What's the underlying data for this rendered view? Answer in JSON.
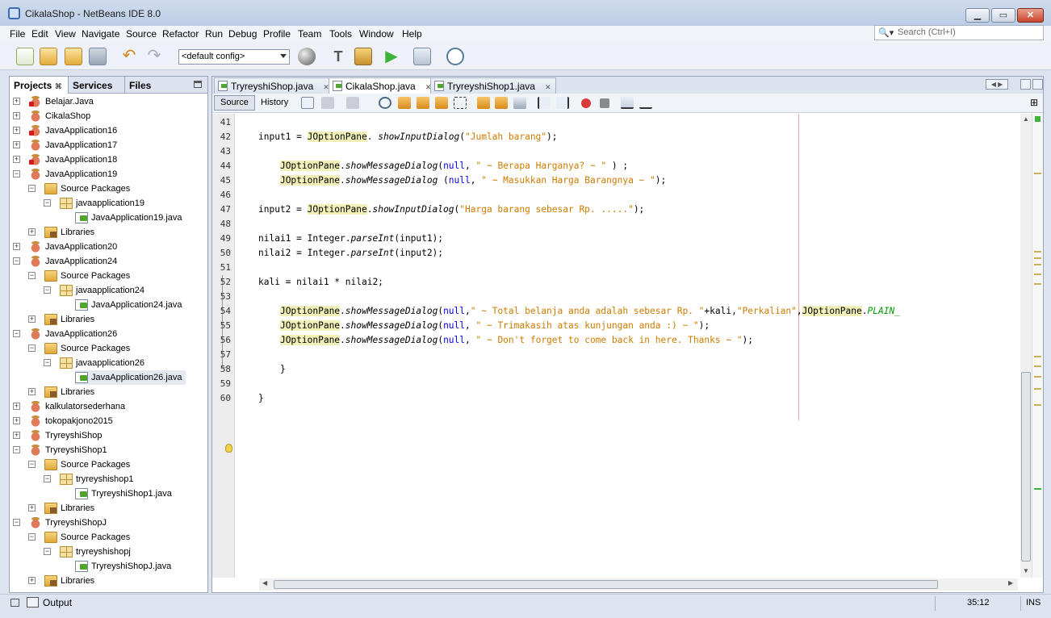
{
  "window": {
    "title": "CikalaShop - NetBeans IDE 8.0"
  },
  "menu": [
    "File",
    "Edit",
    "View",
    "Navigate",
    "Source",
    "Refactor",
    "Run",
    "Debug",
    "Profile",
    "Team",
    "Tools",
    "Window",
    "Help"
  ],
  "search": {
    "placeholder": "Search (Ctrl+I)"
  },
  "toolbar": {
    "config": "<default config>"
  },
  "panel": {
    "tabs": [
      "Projects",
      "Services",
      "Files"
    ]
  },
  "tree": [
    {
      "label": "Belajar.Java",
      "level": 0,
      "type": "project",
      "expanded": false,
      "error": true
    },
    {
      "label": "CikalaShop",
      "level": 0,
      "type": "project",
      "expanded": false,
      "error": false
    },
    {
      "label": "JavaApplication16",
      "level": 0,
      "type": "project",
      "expanded": false,
      "error": true
    },
    {
      "label": "JavaApplication17",
      "level": 0,
      "type": "project",
      "expanded": false,
      "error": false
    },
    {
      "label": "JavaApplication18",
      "level": 0,
      "type": "project",
      "expanded": false,
      "error": true
    },
    {
      "label": "JavaApplication19",
      "level": 0,
      "type": "project",
      "expanded": true,
      "error": false
    },
    {
      "label": "Source Packages",
      "level": 1,
      "type": "folder",
      "expanded": true
    },
    {
      "label": "javaapplication19",
      "level": 2,
      "type": "package",
      "expanded": true
    },
    {
      "label": "JavaApplication19.java",
      "level": 3,
      "type": "java"
    },
    {
      "label": "Libraries",
      "level": 1,
      "type": "lib",
      "expanded": false
    },
    {
      "label": "JavaApplication20",
      "level": 0,
      "type": "project",
      "expanded": false,
      "error": false
    },
    {
      "label": "JavaApplication24",
      "level": 0,
      "type": "project",
      "expanded": true,
      "error": false
    },
    {
      "label": "Source Packages",
      "level": 1,
      "type": "folder",
      "expanded": true
    },
    {
      "label": "javaapplication24",
      "level": 2,
      "type": "package",
      "expanded": true
    },
    {
      "label": "JavaApplication24.java",
      "level": 3,
      "type": "java"
    },
    {
      "label": "Libraries",
      "level": 1,
      "type": "lib",
      "expanded": false
    },
    {
      "label": "JavaApplication26",
      "level": 0,
      "type": "project",
      "expanded": true,
      "error": false
    },
    {
      "label": "Source Packages",
      "level": 1,
      "type": "folder",
      "expanded": true
    },
    {
      "label": "javaapplication26",
      "level": 2,
      "type": "package",
      "expanded": true
    },
    {
      "label": "JavaApplication26.java",
      "level": 3,
      "type": "java",
      "selected": true
    },
    {
      "label": "Libraries",
      "level": 1,
      "type": "lib",
      "expanded": false
    },
    {
      "label": "kalkulatorsederhana",
      "level": 0,
      "type": "project",
      "expanded": false,
      "error": false
    },
    {
      "label": "tokopakjono2015",
      "level": 0,
      "type": "project",
      "expanded": false,
      "error": false
    },
    {
      "label": "TryreyshiShop",
      "level": 0,
      "type": "project",
      "expanded": false,
      "error": false
    },
    {
      "label": "TryreyshiShop1",
      "level": 0,
      "type": "project",
      "expanded": true,
      "error": false
    },
    {
      "label": "Source Packages",
      "level": 1,
      "type": "folder",
      "expanded": true
    },
    {
      "label": "tryreyshishop1",
      "level": 2,
      "type": "package",
      "expanded": true
    },
    {
      "label": "TryreyshiShop1.java",
      "level": 3,
      "type": "java"
    },
    {
      "label": "Libraries",
      "level": 1,
      "type": "lib",
      "expanded": false
    },
    {
      "label": "TryreyshiShopJ",
      "level": 0,
      "type": "project",
      "expanded": true,
      "error": false
    },
    {
      "label": "Source Packages",
      "level": 1,
      "type": "folder",
      "expanded": true
    },
    {
      "label": "tryreyshishopj",
      "level": 2,
      "type": "package",
      "expanded": true
    },
    {
      "label": "TryreyshiShopJ.java",
      "level": 3,
      "type": "java"
    },
    {
      "label": "Libraries",
      "level": 1,
      "type": "lib",
      "expanded": false
    }
  ],
  "editor": {
    "tabs": [
      {
        "label": "TryreyshiShop.java",
        "active": false
      },
      {
        "label": "CikalaShop.java",
        "active": true
      },
      {
        "label": "TryreyshiShop1.java",
        "active": false
      }
    ],
    "source_label": "Source",
    "history_label": "History",
    "lines": [
      {
        "n": "41",
        "segs": []
      },
      {
        "n": "42",
        "segs": [
          [
            "",
            "input1 = "
          ],
          [
            "cls",
            "JOptionPane"
          ],
          [
            "",
            ". "
          ],
          [
            "mth",
            "showInputDialog"
          ],
          [
            "",
            "("
          ],
          [
            "str",
            "\"Jumlah barang\""
          ],
          [
            "",
            ");"
          ]
        ]
      },
      {
        "n": "43",
        "segs": []
      },
      {
        "n": "44",
        "segs": [
          [
            "",
            "    "
          ],
          [
            "cls",
            "JOptionPane"
          ],
          [
            "",
            "."
          ],
          [
            "mth",
            "showMessageDialog"
          ],
          [
            "",
            "("
          ],
          [
            "kw",
            "null"
          ],
          [
            "",
            ", "
          ],
          [
            "str",
            "\" ~ Berapa Harganya? ~ \""
          ],
          [
            "",
            " ) ;"
          ]
        ]
      },
      {
        "n": "45",
        "segs": [
          [
            "",
            "    "
          ],
          [
            "cls",
            "JOptionPane"
          ],
          [
            "",
            "."
          ],
          [
            "mth",
            "showMessageDialog"
          ],
          [
            "",
            " ("
          ],
          [
            "kw",
            "null"
          ],
          [
            "",
            ", "
          ],
          [
            "str",
            "\" ~ Masukkan Harga Barangnya ~ \""
          ],
          [
            "",
            ");"
          ]
        ]
      },
      {
        "n": "46",
        "segs": []
      },
      {
        "n": "47",
        "segs": [
          [
            "",
            "input2 = "
          ],
          [
            "cls",
            "JOptionPane"
          ],
          [
            "",
            "."
          ],
          [
            "mth",
            "showInputDialog"
          ],
          [
            "",
            "("
          ],
          [
            "str",
            "\"Harga barang sebesar Rp. .....\""
          ],
          [
            "",
            ");"
          ]
        ]
      },
      {
        "n": "48",
        "segs": []
      },
      {
        "n": "49",
        "segs": [
          [
            "",
            "nilai1 = Integer."
          ],
          [
            "mth",
            "parseInt"
          ],
          [
            "",
            "(input1);"
          ]
        ]
      },
      {
        "n": "50",
        "segs": [
          [
            "",
            "nilai2 = Integer."
          ],
          [
            "mth",
            "parseInt"
          ],
          [
            "",
            "(input2);"
          ]
        ]
      },
      {
        "n": "51",
        "segs": []
      },
      {
        "n": "52",
        "segs": [
          [
            "",
            "kali = nilai1 * nilai2;"
          ]
        ]
      },
      {
        "n": "53",
        "segs": []
      },
      {
        "n": "54",
        "segs": [
          [
            "",
            "    "
          ],
          [
            "cls",
            "JOptionPane"
          ],
          [
            "",
            "."
          ],
          [
            "mth",
            "showMessageDialog"
          ],
          [
            "",
            "("
          ],
          [
            "kw",
            "null"
          ],
          [
            "",
            ","
          ],
          [
            "str",
            "\" ~ Total belanja anda adalah sebesar Rp. \""
          ],
          [
            "",
            "+kali,"
          ],
          [
            "str",
            "\"Perkalian\""
          ],
          [
            "",
            ","
          ],
          [
            "cls",
            "JOptionPane"
          ],
          [
            "",
            "."
          ],
          [
            "cst",
            "PLAIN_"
          ]
        ]
      },
      {
        "n": "55",
        "segs": [
          [
            "",
            "    "
          ],
          [
            "cls",
            "JOptionPane"
          ],
          [
            "",
            "."
          ],
          [
            "mth",
            "showMessageDialog"
          ],
          [
            "",
            "("
          ],
          [
            "kw",
            "null"
          ],
          [
            "",
            ", "
          ],
          [
            "str",
            "\" ~ Trimakasih atas kunjungan anda :) ~ \""
          ],
          [
            "",
            ");"
          ]
        ]
      },
      {
        "n": "56",
        "segs": [
          [
            "",
            "    "
          ],
          [
            "cls",
            "JOptionPane"
          ],
          [
            "",
            "."
          ],
          [
            "mth",
            "showMessageDialog"
          ],
          [
            "",
            "("
          ],
          [
            "kw",
            "null"
          ],
          [
            "",
            ", "
          ],
          [
            "str",
            "\" ~ Don't forget to come back in here. Thanks ~ \""
          ],
          [
            "",
            ");"
          ]
        ]
      },
      {
        "n": "57",
        "segs": []
      },
      {
        "n": "58",
        "segs": [
          [
            "",
            "    }"
          ]
        ]
      },
      {
        "n": "59",
        "segs": []
      },
      {
        "n": "60",
        "segs": [
          [
            "",
            "}"
          ]
        ]
      }
    ]
  },
  "status": {
    "output_label": "Output",
    "position": "35:12",
    "mode": "INS"
  }
}
